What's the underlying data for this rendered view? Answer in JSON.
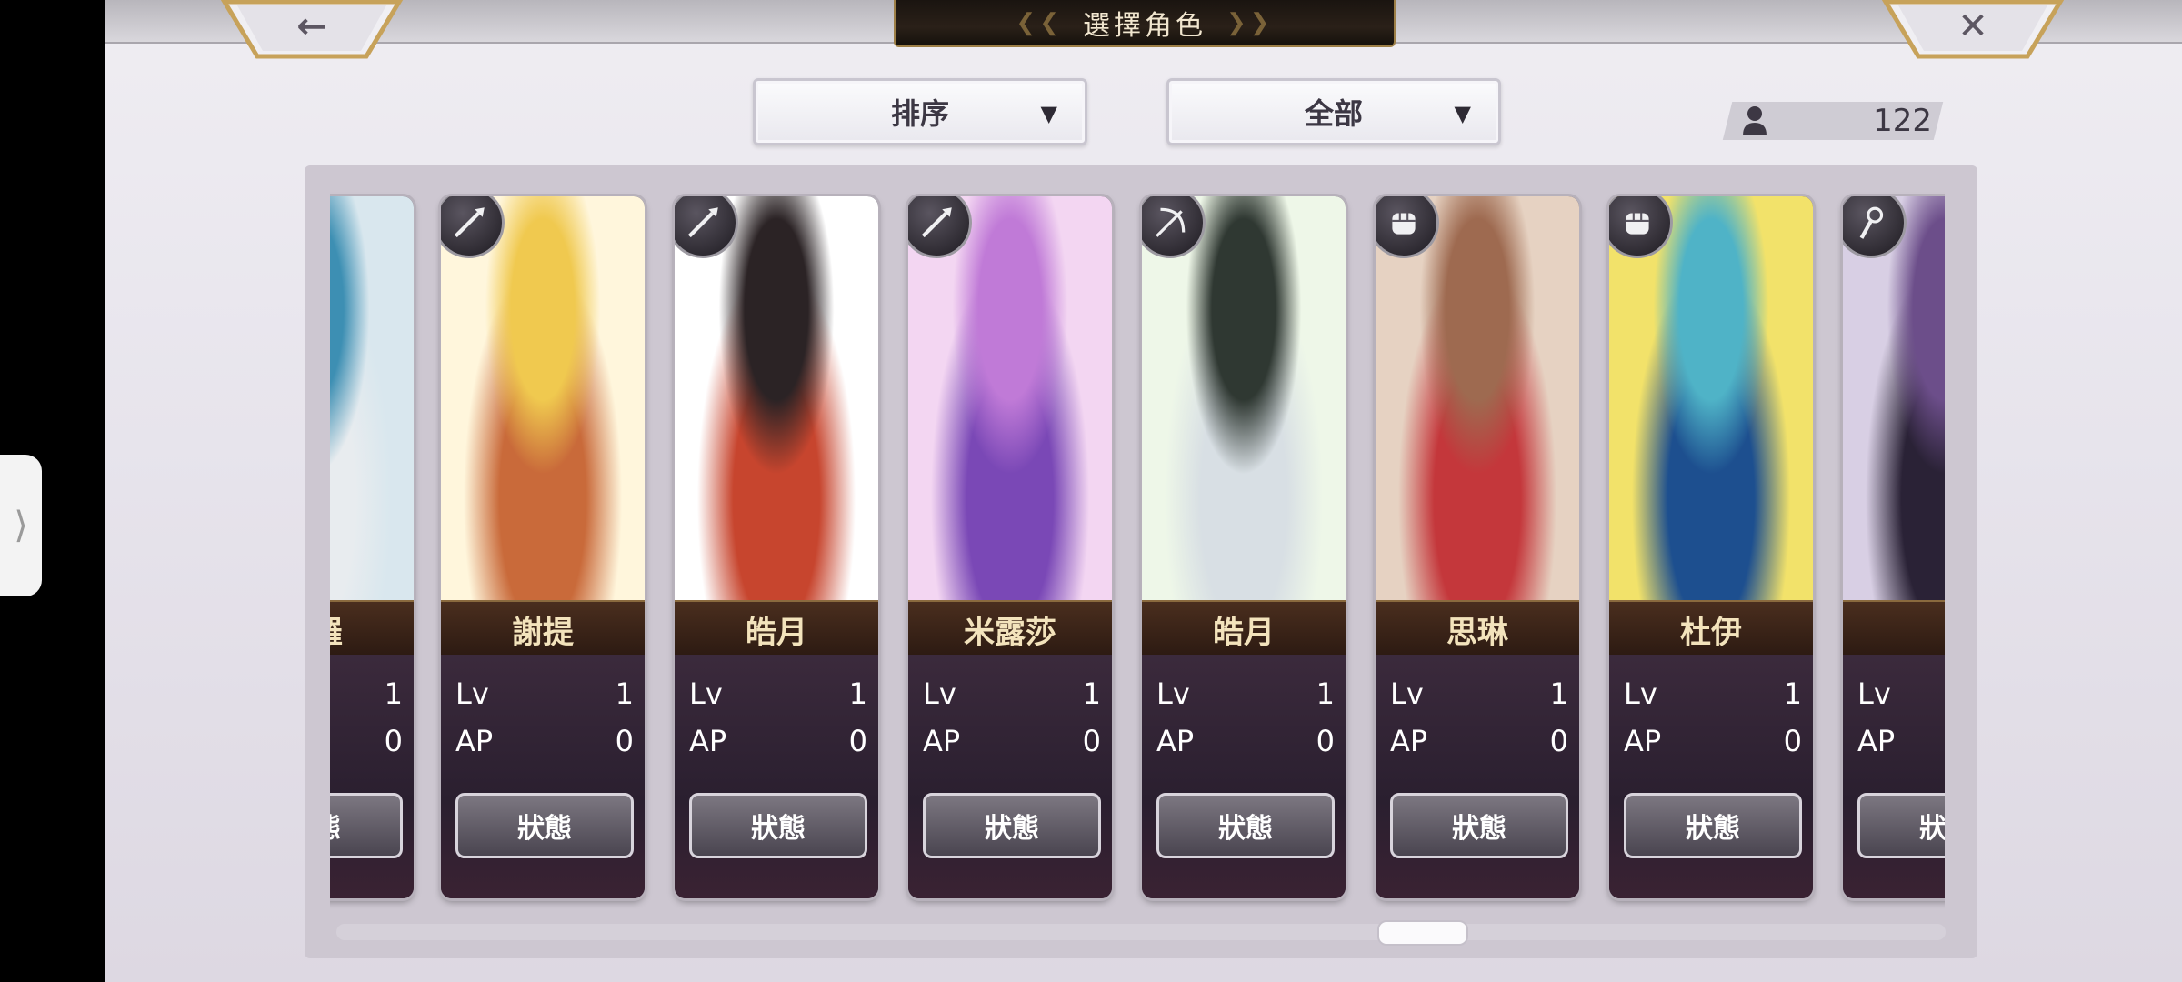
{
  "screen": {
    "title": "選擇角色",
    "back_icon": "←",
    "close_icon": "✕",
    "side_handle_icon": "⟩"
  },
  "filters": {
    "sort_label": "排序",
    "filter_label": "全部",
    "caret": "▼"
  },
  "roster_count": "122",
  "labels": {
    "lv": "Lv",
    "ap": "AP",
    "status": "狀態"
  },
  "characters": [
    {
      "name": "維羅",
      "lv": "1",
      "ap": "0",
      "class_icon": "partial",
      "colors": [
        "#d9e7ee",
        "#3d8fb3",
        "#e8ecef"
      ]
    },
    {
      "name": "謝提",
      "lv": "1",
      "ap": "0",
      "class_icon": "spear-icon",
      "colors": [
        "#fff6dc",
        "#f0c94f",
        "#c96a3a"
      ]
    },
    {
      "name": "皓月",
      "lv": "1",
      "ap": "0",
      "class_icon": "spear-icon",
      "colors": [
        "#ffffff",
        "#2b2325",
        "#c7452e"
      ]
    },
    {
      "name": "米露莎",
      "lv": "1",
      "ap": "0",
      "class_icon": "spear-icon",
      "colors": [
        "#f3d6f2",
        "#c07ad7",
        "#7a48b6"
      ]
    },
    {
      "name": "皓月",
      "lv": "1",
      "ap": "0",
      "class_icon": "bow-icon",
      "colors": [
        "#eef7e8",
        "#2f3832",
        "#d8dfe4"
      ]
    },
    {
      "name": "思琳",
      "lv": "1",
      "ap": "0",
      "class_icon": "fist-icon",
      "colors": [
        "#e6d2c2",
        "#9e6a50",
        "#c4373b"
      ]
    },
    {
      "name": "杜伊",
      "lv": "1",
      "ap": "0",
      "class_icon": "fist-icon",
      "colors": [
        "#f2e26a",
        "#4fb3c7",
        "#1d4f8f"
      ]
    },
    {
      "name": "",
      "lv": "",
      "ap": "",
      "class_icon": "staff-icon",
      "colors": [
        "#d8cfe4",
        "#6c4e8a",
        "#2a2236"
      ]
    }
  ]
}
